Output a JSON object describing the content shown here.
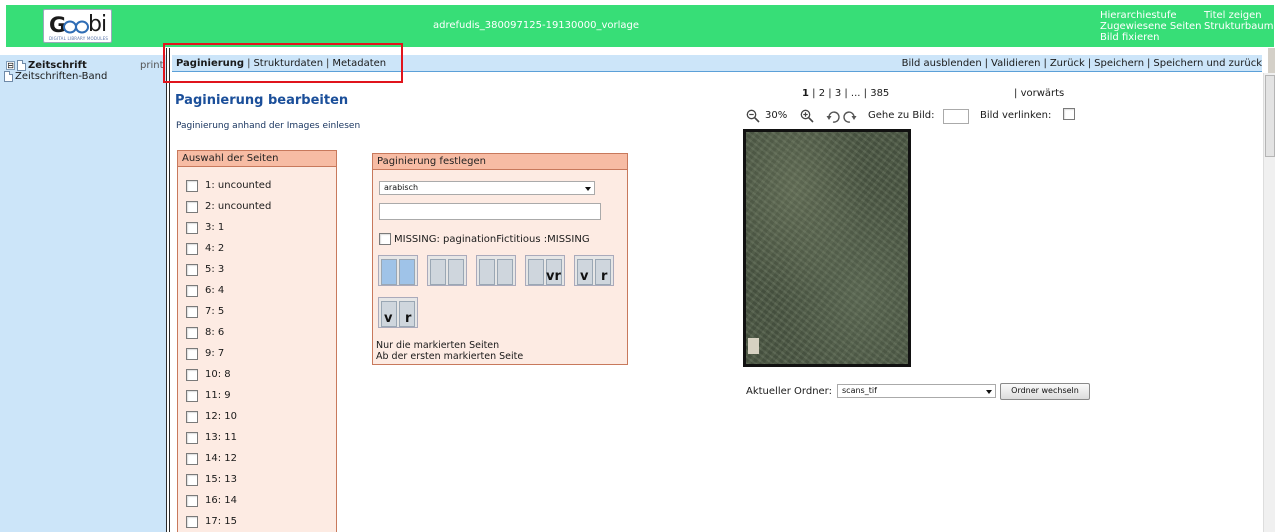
{
  "header": {
    "logo_text": "Goobi",
    "logo_tagline": "DIGITAL LIBRARY MODULES",
    "title": "adrefudis_380097125-19130000_vorlage",
    "menu_col1": [
      "Hierarchiestufe",
      "Zugewiesene Seiten",
      "Bild fixieren"
    ],
    "menu_col2": [
      "Titel zeigen",
      "Strukturbaum"
    ]
  },
  "sidebar": {
    "tree": [
      {
        "label": "Zeitschrift",
        "expander": "⊟"
      },
      {
        "label": "Zeitschriften-Band"
      }
    ],
    "print_label": "print"
  },
  "tabs": {
    "items": [
      "Paginierung",
      "Strukturdaten",
      "Metadaten"
    ],
    "active": "Paginierung"
  },
  "actions": [
    "Bild ausblenden",
    "Validieren",
    "Zurück",
    "Speichern",
    "Speichern und zurück"
  ],
  "main": {
    "title": "Paginierung bearbeiten",
    "read_from_images_link": "Paginierung anhand der Images einlesen"
  },
  "page_selection": {
    "header": "Auswahl der Seiten",
    "pages": [
      "1: uncounted",
      "2: uncounted",
      "3: 1",
      "4: 2",
      "5: 3",
      "6: 4",
      "7: 5",
      "8: 6",
      "9: 7",
      "10: 8",
      "11: 9",
      "12: 10",
      "13: 11",
      "14: 12",
      "15: 13",
      "16: 14",
      "17: 15"
    ]
  },
  "pagination": {
    "header": "Paginierung festlegen",
    "type_selected": "arabisch",
    "start_value": "",
    "fictitious_label": "MISSING: paginationFictitious :MISSING",
    "mode_buttons": [
      "single-page",
      "double-page",
      "column",
      "recto-verso",
      "verso-recto-a",
      "verso-recto-b"
    ],
    "glyphs": {
      "vr": "vr",
      "v": "v",
      "r": "r"
    },
    "apply_marked_only": "Nur die markierten Seiten",
    "apply_from_first": "Ab der ersten markierten Seite"
  },
  "viewer": {
    "pager": {
      "current": "1",
      "pages": [
        "2",
        "3",
        "...",
        "385"
      ]
    },
    "forward_label": "vorwärts",
    "zoom": "30%",
    "goto_label": "Gehe zu Bild:",
    "goto_value": "",
    "link_image_label": "Bild verlinken:",
    "folder_label": "Aktueller Ordner:",
    "folder_selected": "scans_tif",
    "change_folder_button": "Ordner wechseln"
  },
  "colors": {
    "header_green": "#37de77",
    "sidebar_blue": "#cce5f9",
    "title_blue": "#1b4f9a",
    "box_bg": "#fdebe3",
    "box_head": "#f7bca4",
    "highlight_red": "#e0141c"
  }
}
